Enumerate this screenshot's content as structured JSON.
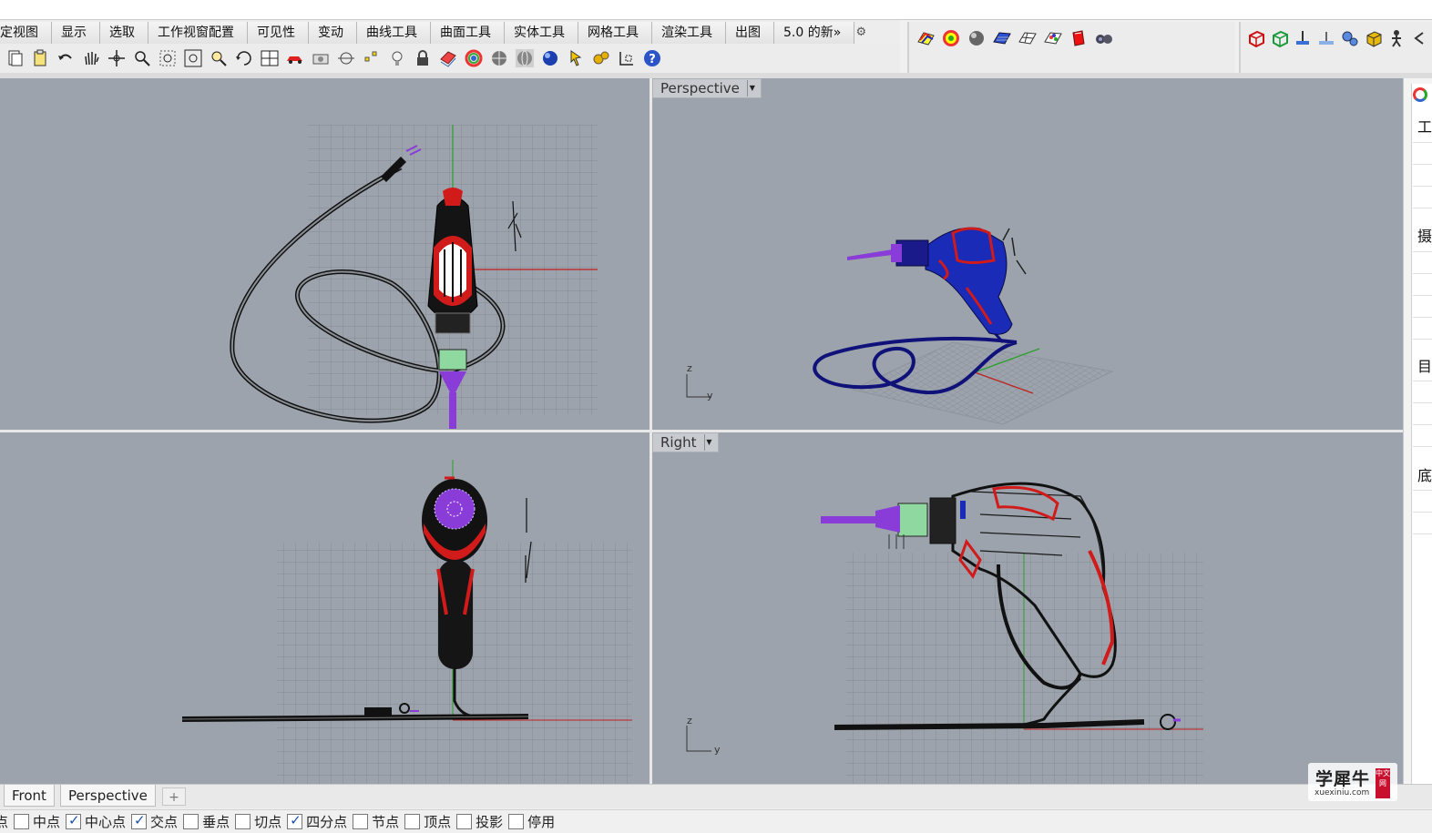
{
  "menu_tabs": [
    "定视图",
    "显示",
    "选取",
    "工作视窗配置",
    "可见性",
    "变动",
    "曲线工具",
    "曲面工具",
    "实体工具",
    "网格工具",
    "渲染工具",
    "出图",
    "5.0 的新»"
  ],
  "toolbar_icons": [
    "new-file-icon",
    "clipboard-icon",
    "undo-icon",
    "pan-hand-icon",
    "move-icon",
    "zoom-icon",
    "zoom-window-icon",
    "zoom-extents-icon",
    "zoom-selected-icon",
    "rotate-view-icon",
    "four-viewports-icon",
    "car-icon",
    "camera-icon",
    "circle-snap-icon",
    "points-icon",
    "light-bulb-icon",
    "lock-icon",
    "layer-icon",
    "color-wheel-icon",
    "shaded-sphere-icon",
    "wire-sphere-icon",
    "render-sphere-icon",
    "pointer-icon",
    "settings-gear-icon",
    "grid-snap-icon",
    "help-icon"
  ],
  "render_icons": [
    "rainbow-surface-icon",
    "color-ball-icon",
    "gray-sphere-icon",
    "blue-plane-icon",
    "mesh-plane-icon",
    "color-mesh-icon",
    "red-box-icon",
    "binoculars-icon"
  ],
  "solid_icons": [
    "red-box-solid-icon",
    "green-box-solid-icon",
    "extrude-icon",
    "plane-extrude-icon",
    "gears-icon",
    "gold-box-icon",
    "person-icon",
    "arrow-more-icon"
  ],
  "viewports": {
    "top": {
      "label": ""
    },
    "perspective": {
      "label": "Perspective"
    },
    "front": {
      "label": ""
    },
    "right": {
      "label": "Right"
    }
  },
  "axis_labels": {
    "z": "z",
    "y": "y"
  },
  "right_panel_chars": [
    "工",
    "摄",
    "目",
    "底"
  ],
  "bottom_tabs": [
    "Front",
    "Perspective"
  ],
  "add_tab": "+",
  "snaps": [
    {
      "label": "点",
      "checked": false,
      "partial": true
    },
    {
      "label": "中点",
      "checked": false
    },
    {
      "label": "中心点",
      "checked": true
    },
    {
      "label": "交点",
      "checked": true
    },
    {
      "label": "垂点",
      "checked": false
    },
    {
      "label": "切点",
      "checked": false
    },
    {
      "label": "四分点",
      "checked": true
    },
    {
      "label": "节点",
      "checked": false
    },
    {
      "label": "顶点",
      "checked": false
    },
    {
      "label": "投影",
      "checked": false
    },
    {
      "label": "停用",
      "checked": false
    }
  ],
  "watermark": {
    "main": "学犀牛",
    "sub": "xuexiniu.com",
    "badge": "中文网"
  },
  "colors": {
    "viewport_bg": "#9ca3ac",
    "drill_red": "#d11a1a",
    "cord_purple": "#8a3cd8",
    "drill_blue": "#1a2bb8"
  }
}
